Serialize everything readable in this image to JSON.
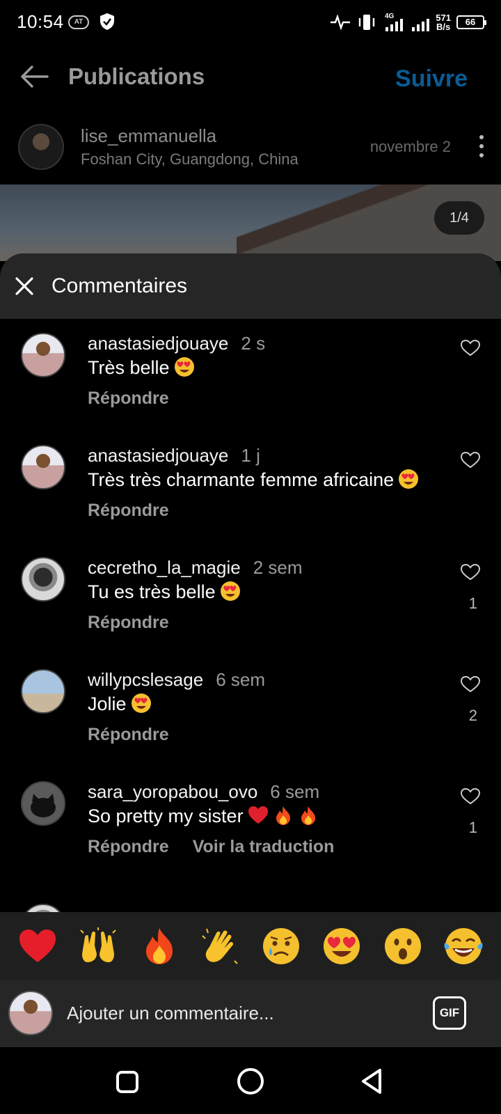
{
  "status_bar": {
    "time": "10:54",
    "net_speed": "571",
    "net_unit": "B/s",
    "network": "4G",
    "battery": "66",
    "badge": "AT"
  },
  "header": {
    "title": "Publications",
    "follow_label": "Suivre",
    "follow_color": "#0a5c95"
  },
  "post": {
    "author": "lise_emmanuella",
    "location": "Foshan City, Guangdong, China",
    "date": "novembre 2",
    "photo_counter": "1/4"
  },
  "comments_sheet": {
    "title": "Commentaires",
    "reply_label": "Répondre",
    "translate_label": "Voir la traduction",
    "comments": [
      {
        "user": "anastasiedjouaye",
        "time": "2 s",
        "text": "Très belle",
        "emojis": [
          "heart-eyes"
        ],
        "likes": ""
      },
      {
        "user": "anastasiedjouaye",
        "time": "1 j",
        "text": "Très très charmante femme africaine",
        "emojis": [
          "heart-eyes"
        ],
        "likes": ""
      },
      {
        "user": "cecretho_la_magie",
        "time": "2 sem",
        "text": "Tu es très belle",
        "emojis": [
          "heart-eyes"
        ],
        "likes": "1"
      },
      {
        "user": "willypcslesage",
        "time": "6 sem",
        "text": "Jolie",
        "emojis": [
          "heart-eyes"
        ],
        "likes": "2"
      },
      {
        "user": "sara_yoropabou_ovo",
        "time": "6 sem",
        "text": "So pretty my sister",
        "emojis": [
          "red-heart",
          "fire",
          "fire"
        ],
        "likes": "1"
      }
    ]
  },
  "reactions": [
    "red-heart",
    "raising-hands",
    "fire",
    "clapping-hands",
    "sad-tear",
    "heart-eyes",
    "surprised",
    "tears-of-joy"
  ],
  "composer": {
    "placeholder": "Ajouter un commentaire...",
    "gif_label": "GIF"
  },
  "colors": {
    "background": "#000000",
    "sheet_header": "#262626",
    "muted_text": "#9a9a9a"
  }
}
